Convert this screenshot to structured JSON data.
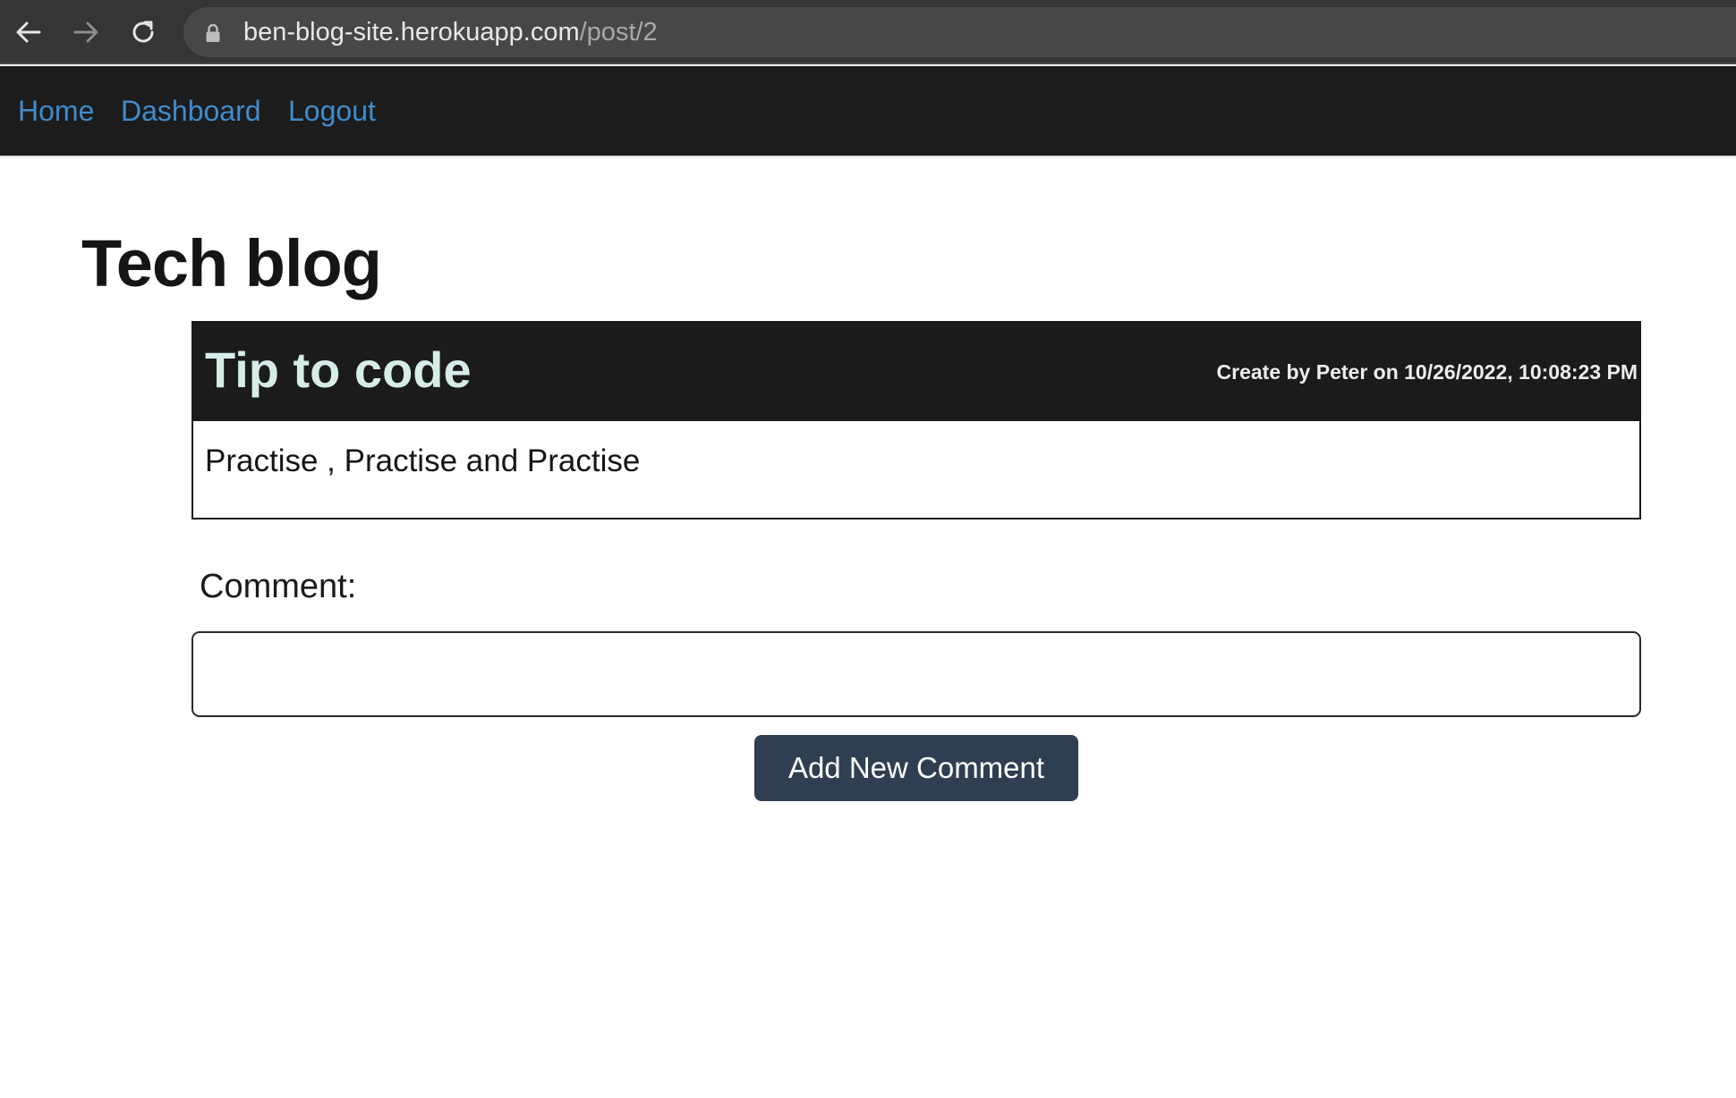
{
  "browser": {
    "url_host": "ben-blog-site.herokuapp.com",
    "url_path": "/post/2",
    "icons": [
      "back-arrow-icon",
      "forward-arrow-icon",
      "reload-icon",
      "lock-icon"
    ]
  },
  "nav": {
    "home": "Home",
    "dashboard": "Dashboard",
    "logout": "Logout",
    "link_color": "#3f8ccc",
    "background": "#1c1c1c"
  },
  "page": {
    "title": "Tech blog"
  },
  "post": {
    "title": "Tip to code",
    "meta": "Create by Peter on 10/26/2022, 10:08:23 PM",
    "body": "Practise , Practise and Practise"
  },
  "comment": {
    "label": "Comment:",
    "value": "",
    "button": "Add New Comment",
    "button_color": "#2f3e50"
  }
}
